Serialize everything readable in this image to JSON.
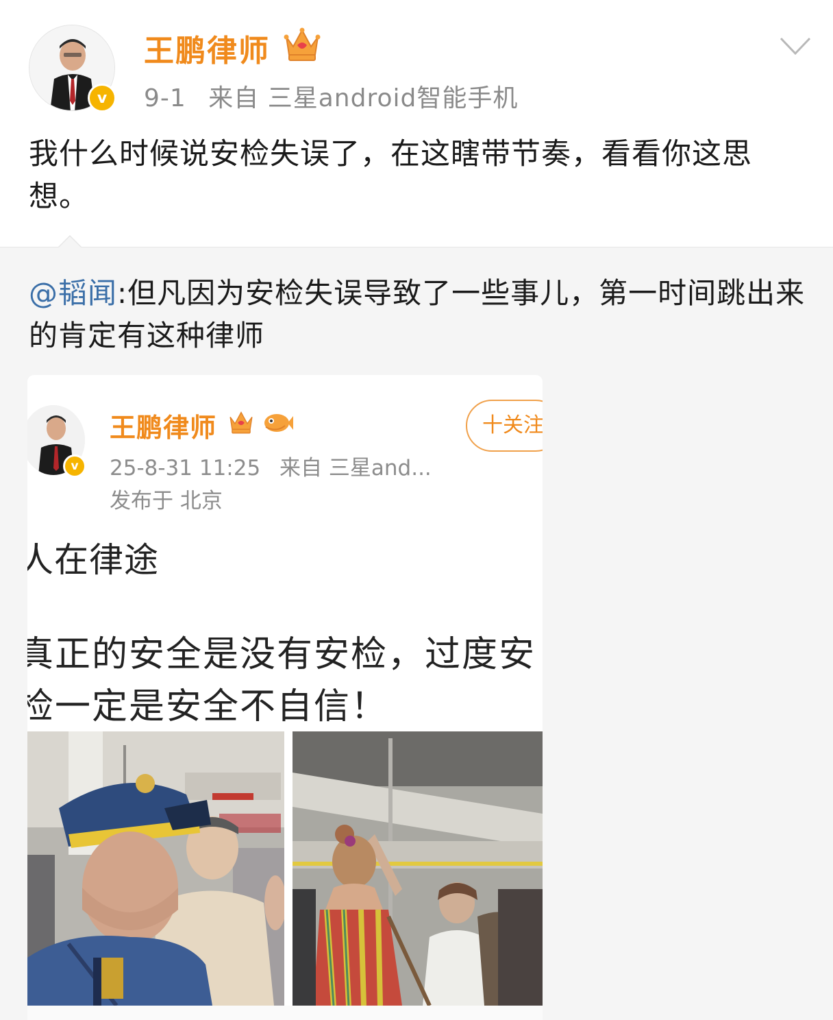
{
  "post": {
    "username": "王鹏律师",
    "date": "9-1",
    "source": "来自 三星android智能手机",
    "verified_mark": "v",
    "text": "我什么时候说安检失误了，在这瞎带节奏，看看你这思想。",
    "icons": {
      "crown": "crown-icon",
      "verified": "verified-badge-icon",
      "menu": "chevron-down-icon"
    }
  },
  "repost": {
    "mention": "@韬闻",
    "text": ":但凡因为安检失误导致了一些事儿，第一时间跳出来的肯定有这种律师"
  },
  "embedded": {
    "username": "王鹏律师",
    "verified_mark": "v",
    "follow_label": "十关注",
    "timestamp": "25-8-31 11:25",
    "source": "来自 三星and...",
    "location": "发布于 北京",
    "title": "人在律途",
    "body_line1": "真正的安全是没有安检，过度安",
    "body_line2": "检一定是安全不自信！",
    "colors": {
      "brand_orange": "#f08a1c",
      "mention_blue": "#3b6fa8",
      "meta_gray": "#8a8a8a"
    }
  }
}
